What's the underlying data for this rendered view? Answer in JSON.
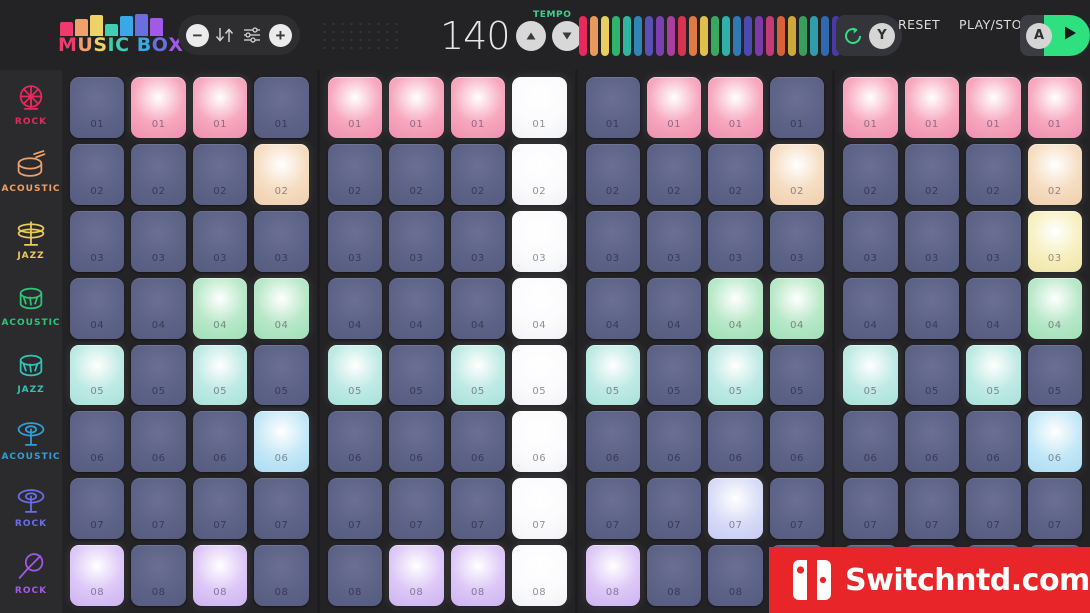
{
  "app": {
    "title": "MUSIC BOX",
    "logo_letters": [
      {
        "ch": "M",
        "color": "#ef3a6e"
      },
      {
        "ch": "U",
        "color": "#f0a06a"
      },
      {
        "ch": "S",
        "color": "#edd267"
      },
      {
        "ch": "I",
        "color": "#3ecf9e"
      },
      {
        "ch": "C",
        "color": "#3ecfb6"
      },
      {
        "ch": " ",
        "color": "#ffffff"
      },
      {
        "ch": "B",
        "color": "#3aa8e8"
      },
      {
        "ch": "O",
        "color": "#6b6ee0"
      },
      {
        "ch": "X",
        "color": "#a259e8"
      }
    ],
    "logo_bars": [
      "#ef3a6e",
      "#f0a06a",
      "#edd267",
      "#3ecfb6",
      "#3aa8e8",
      "#6b6ee0",
      "#a259e8"
    ]
  },
  "toolbar": {
    "minus_label": "−",
    "plus_label": "+",
    "sort_icon": "sort-updown-icon",
    "sliders_icon": "sliders-icon"
  },
  "tempo": {
    "label": "TEMPO",
    "value": "140",
    "up_label": "▲",
    "down_label": "▼",
    "accent": "#3ecf8e"
  },
  "equalizer": {
    "bars": [
      {
        "color": "#e8295e",
        "height": 40
      },
      {
        "color": "#e89a5e",
        "height": 40
      },
      {
        "color": "#e8cf5e",
        "height": 40
      },
      {
        "color": "#2fb56b",
        "height": 40
      },
      {
        "color": "#2fb5a0",
        "height": 40
      },
      {
        "color": "#2f86b5",
        "height": 40
      },
      {
        "color": "#5a4fb5",
        "height": 40
      },
      {
        "color": "#7a3fb0",
        "height": 40
      },
      {
        "color": "#a83f9e",
        "height": 40
      },
      {
        "color": "#d8344f",
        "height": 40
      },
      {
        "color": "#e07a45",
        "height": 40
      },
      {
        "color": "#e0c04a",
        "height": 40
      },
      {
        "color": "#3aa85e",
        "height": 40
      },
      {
        "color": "#2fb0a8",
        "height": 40
      },
      {
        "color": "#2f7ab5",
        "height": 40
      },
      {
        "color": "#4a4ab0",
        "height": 40
      },
      {
        "color": "#7a3aa8",
        "height": 40
      },
      {
        "color": "#c23a7a",
        "height": 40
      },
      {
        "color": "#d8603a",
        "height": 40
      },
      {
        "color": "#cfa83a",
        "height": 40
      },
      {
        "color": "#3a9e5e",
        "height": 40
      },
      {
        "color": "#2f9ea8",
        "height": 40
      },
      {
        "color": "#2f6ab0",
        "height": 40
      },
      {
        "color": "#4a3aa8",
        "height": 40
      },
      {
        "color": "#6b2f9e",
        "height": 40
      }
    ]
  },
  "controls": {
    "reset_label": "RESET",
    "reset_button_letter": "Y",
    "reset_icon": "refresh-circle-icon",
    "playstop_label": "PLAY/STOP",
    "play_button_letter": "A",
    "play_icon": "play-triangle-icon",
    "green": "#2ee07f"
  },
  "sidebar": {
    "items": [
      {
        "label": "ROCK",
        "color": "#e8285e",
        "icon": "cymbal-rock-icon"
      },
      {
        "label": "ACOUSTIC",
        "color": "#eca06a",
        "icon": "snare-drum-icon"
      },
      {
        "label": "JAZZ",
        "color": "#e8cc5e",
        "icon": "hi-hat-icon"
      },
      {
        "label": "ACOUSTIC",
        "color": "#2fc47a",
        "icon": "tom-drum-icon"
      },
      {
        "label": "JAZZ",
        "color": "#2fc4b5",
        "icon": "floor-tom-icon"
      },
      {
        "label": "ACOUSTIC",
        "color": "#2f9fd8",
        "icon": "ride-cymbal-icon"
      },
      {
        "label": "ROCK",
        "color": "#6b6ee8",
        "icon": "crash-cymbal-icon"
      },
      {
        "label": "ROCK",
        "color": "#a259e8",
        "icon": "shaker-icon"
      }
    ]
  },
  "grid": {
    "rows": 8,
    "groups": 4,
    "cols_per_group": 4,
    "row_numbers": [
      "01",
      "02",
      "03",
      "04",
      "05",
      "06",
      "07",
      "08"
    ],
    "row_colors": [
      {
        "glow": "#ffffff",
        "mid": "#f7a8bf",
        "edge": "#ef8fae"
      },
      {
        "glow": "#ffffff",
        "mid": "#f6ddc2",
        "edge": "#f0cfae"
      },
      {
        "glow": "#ffffff",
        "mid": "#f7f0c0",
        "edge": "#efe5a8"
      },
      {
        "glow": "#ffffff",
        "mid": "#b8e8c8",
        "edge": "#9fe0b8"
      },
      {
        "glow": "#ffffff",
        "mid": "#bfeae4",
        "edge": "#a8e2db"
      },
      {
        "glow": "#ffffff",
        "mid": "#c4e8f7",
        "edge": "#aadcf2"
      },
      {
        "glow": "#ffffff",
        "mid": "#d8dcf7",
        "edge": "#c6cbf2"
      },
      {
        "glow": "#ffffff",
        "mid": "#ddc8f7",
        "edge": "#cdb3f2"
      }
    ],
    "playhead_column": {
      "group": 1,
      "col": 3
    },
    "active": [
      [
        false,
        true,
        true,
        false,
        true,
        true,
        true,
        true,
        false,
        true,
        true,
        false,
        true,
        true,
        true,
        true
      ],
      [
        false,
        false,
        false,
        true,
        false,
        false,
        false,
        true,
        false,
        false,
        false,
        true,
        false,
        false,
        false,
        true
      ],
      [
        false,
        false,
        false,
        false,
        false,
        false,
        false,
        true,
        false,
        false,
        false,
        false,
        false,
        false,
        false,
        true
      ],
      [
        false,
        false,
        true,
        true,
        false,
        false,
        false,
        true,
        false,
        false,
        true,
        true,
        false,
        false,
        false,
        true
      ],
      [
        true,
        false,
        true,
        false,
        true,
        false,
        true,
        false,
        true,
        false,
        true,
        false,
        true,
        false,
        true,
        false
      ],
      [
        false,
        false,
        false,
        true,
        false,
        false,
        false,
        false,
        false,
        false,
        false,
        false,
        false,
        false,
        false,
        true
      ],
      [
        false,
        false,
        false,
        false,
        false,
        false,
        false,
        false,
        false,
        false,
        true,
        false,
        false,
        false,
        false,
        false
      ],
      [
        true,
        false,
        true,
        false,
        false,
        true,
        true,
        false,
        true,
        false,
        false,
        false,
        false,
        false,
        false,
        false
      ]
    ]
  },
  "watermark": {
    "text": "Switchntd.com",
    "bg": "#e8262a",
    "logo_icon": "switch-console-icon"
  }
}
